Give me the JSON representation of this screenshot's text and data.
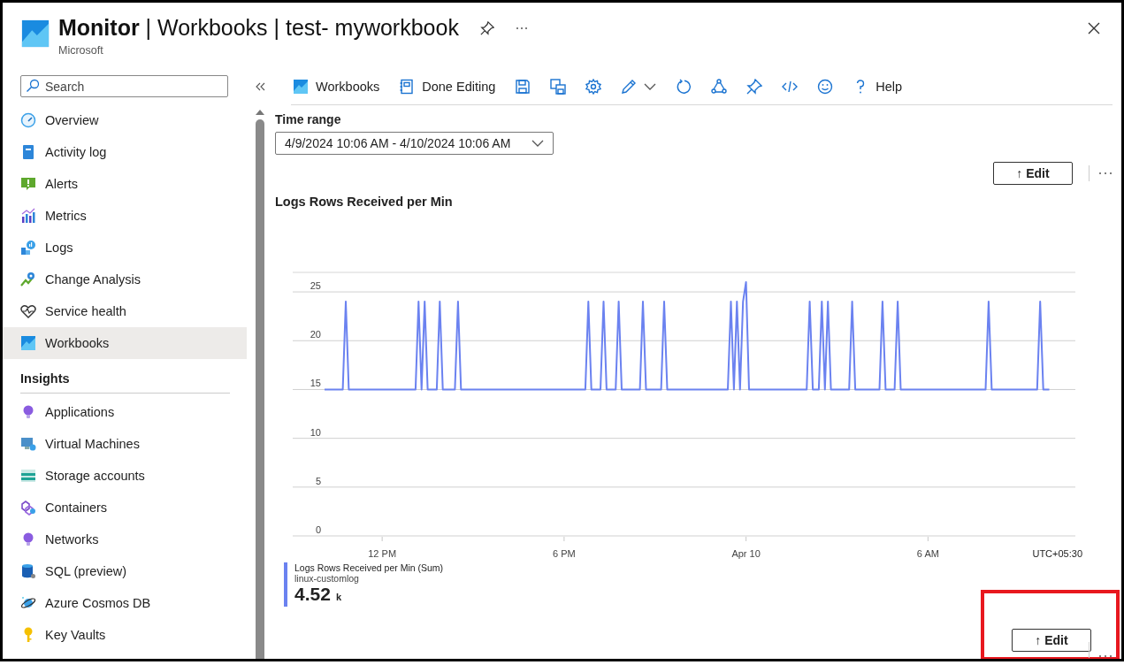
{
  "header": {
    "title": "**Monitor** | Workbooks | test- myworkbook",
    "subtitle": "Microsoft"
  },
  "sidebar": {
    "search": {
      "placeholder": "Search"
    },
    "sections": [
      {
        "items": [
          {
            "label": "Overview",
            "selected": false
          },
          {
            "label": "Activity log",
            "selected": false
          },
          {
            "label": "Alerts",
            "selected": false
          },
          {
            "label": "Metrics",
            "selected": false
          },
          {
            "label": "Logs",
            "selected": false
          },
          {
            "label": "Change Analysis",
            "selected": false
          },
          {
            "label": "Service health",
            "selected": false
          },
          {
            "label": "Workbooks",
            "selected": true
          }
        ]
      },
      {
        "heading": "Insights",
        "items": [
          {
            "label": "Applications",
            "selected": false
          },
          {
            "label": "Virtual Machines",
            "selected": false
          },
          {
            "label": "Storage accounts",
            "selected": false
          },
          {
            "label": "Containers",
            "selected": false
          },
          {
            "label": "Networks",
            "selected": false
          },
          {
            "label": "SQL (preview)",
            "selected": false
          },
          {
            "label": "Azure Cosmos DB",
            "selected": false
          },
          {
            "label": "Key Vaults",
            "selected": false
          }
        ]
      }
    ]
  },
  "toolbar": [
    {
      "kind": "labeled",
      "label": "Workbooks"
    },
    {
      "kind": "labeled",
      "label": "Done Editing"
    },
    {
      "kind": "icon"
    },
    {
      "kind": "icon"
    },
    {
      "kind": "icon"
    },
    {
      "kind": "dropdown"
    },
    {
      "kind": "icon"
    },
    {
      "kind": "icon"
    },
    {
      "kind": "icon"
    },
    {
      "kind": "icon"
    },
    {
      "kind": "icon"
    },
    {
      "kind": "labeled",
      "label": "Help"
    }
  ],
  "time_range": {
    "label": "Time range",
    "value": "4/9/2024 10:06 AM - 4/10/2024 10:06 AM"
  },
  "edit_bars": [
    {
      "label": "↑ Edit",
      "highlighted": false
    },
    {
      "label": "↑ Edit",
      "highlighted": true
    }
  ],
  "chart": {
    "timezone_label": "UTC+05:30",
    "legend": {
      "subtitle": "linux-customlog",
      "value": "4.52",
      "unit": "k"
    },
    "chart_data": {
      "type": "line",
      "title": "Logs Rows Received per Min",
      "categories": [
        null,
        null,
        null,
        null,
        null,
        null,
        null,
        null,
        null,
        null,
        null,
        null,
        null,
        null,
        null,
        null,
        null,
        null,
        null,
        "12 PM",
        null,
        null,
        null,
        null,
        null,
        null,
        null,
        null,
        null,
        null,
        null,
        null,
        null,
        null,
        null,
        null,
        null,
        null,
        null,
        null,
        null,
        null,
        null,
        null,
        null,
        null,
        null,
        null,
        null,
        null,
        null,
        null,
        null,
        null,
        null,
        null,
        null,
        null,
        null,
        null,
        null,
        null,
        null,
        null,
        null,
        null,
        null,
        null,
        null,
        null,
        null,
        null,
        null,
        null,
        null,
        null,
        null,
        null,
        null,
        "6 PM",
        null,
        null,
        null,
        null,
        null,
        null,
        null,
        null,
        null,
        null,
        null,
        null,
        null,
        null,
        null,
        null,
        null,
        null,
        null,
        null,
        null,
        null,
        null,
        null,
        null,
        null,
        null,
        null,
        null,
        null,
        null,
        null,
        null,
        null,
        null,
        null,
        null,
        null,
        null,
        null,
        null,
        null,
        null,
        null,
        null,
        null,
        null,
        null,
        null,
        null,
        null,
        null,
        null,
        null,
        null,
        null,
        null,
        null,
        null,
        "Apr 10",
        null,
        null,
        null,
        null,
        null,
        null,
        null,
        null,
        null,
        null,
        null,
        null,
        null,
        null,
        null,
        null,
        null,
        null,
        null,
        null,
        null,
        null,
        null,
        null,
        null,
        null,
        null,
        null,
        null,
        null,
        null,
        null,
        null,
        null,
        null,
        null,
        null,
        null,
        null,
        null,
        null,
        null,
        null,
        null,
        null,
        null,
        null,
        null,
        null,
        null,
        null,
        null,
        null,
        null,
        null,
        null,
        null,
        null,
        null,
        "6 AM",
        null,
        null,
        null,
        null,
        null,
        null,
        null,
        null,
        null,
        null,
        null,
        null,
        null,
        null,
        null,
        null,
        null,
        null,
        null,
        null,
        null,
        null,
        null,
        null,
        null,
        null,
        null,
        null,
        null,
        null,
        null,
        null,
        null,
        null,
        null,
        null,
        null,
        null,
        null,
        null
      ],
      "series": [
        {
          "name": "Logs Rows Received per Min (Sum)",
          "color": "#6b82f0",
          "values": [
            15,
            15,
            15,
            15,
            15,
            15,
            15,
            24,
            15,
            15,
            15,
            15,
            15,
            15,
            15,
            15,
            15,
            15,
            15,
            15,
            15,
            15,
            15,
            15,
            15,
            15,
            15,
            15,
            15,
            15,
            15,
            24,
            15,
            24,
            15,
            15,
            15,
            15,
            24,
            15,
            15,
            15,
            15,
            15,
            24,
            15,
            15,
            15,
            15,
            15,
            15,
            15,
            15,
            15,
            15,
            15,
            15,
            15,
            15,
            15,
            15,
            15,
            15,
            15,
            15,
            15,
            15,
            15,
            15,
            15,
            15,
            15,
            15,
            15,
            15,
            15,
            15,
            15,
            15,
            15,
            15,
            15,
            15,
            15,
            15,
            15,
            15,
            24,
            15,
            15,
            15,
            15,
            24,
            15,
            15,
            15,
            15,
            24,
            15,
            15,
            15,
            15,
            15,
            15,
            15,
            24,
            15,
            15,
            15,
            15,
            15,
            15,
            24,
            15,
            15,
            15,
            15,
            15,
            15,
            15,
            15,
            15,
            15,
            15,
            15,
            15,
            15,
            15,
            15,
            15,
            15,
            15,
            15,
            15,
            24,
            15,
            24,
            15,
            24,
            26,
            15,
            15,
            15,
            15,
            15,
            15,
            15,
            15,
            15,
            15,
            15,
            15,
            15,
            15,
            15,
            15,
            15,
            15,
            15,
            15,
            24,
            15,
            15,
            15,
            24,
            15,
            24,
            15,
            15,
            15,
            15,
            15,
            15,
            15,
            24,
            15,
            15,
            15,
            15,
            15,
            15,
            15,
            15,
            15,
            24,
            15,
            15,
            15,
            15,
            24,
            15,
            15,
            15,
            15,
            15,
            15,
            15,
            15,
            15,
            15,
            15,
            15,
            15,
            15,
            15,
            15,
            15,
            15,
            15,
            15,
            15,
            15,
            15,
            15,
            15,
            15,
            15,
            15,
            15,
            24,
            15,
            15,
            15,
            15,
            15,
            15,
            15,
            15,
            15,
            15,
            15,
            15,
            15,
            15,
            15,
            15,
            24,
            15,
            15,
            15
          ]
        }
      ],
      "grid": true,
      "ylim": [
        0,
        27
      ],
      "yticks": [
        0,
        5,
        10,
        15,
        20,
        25
      ]
    }
  }
}
